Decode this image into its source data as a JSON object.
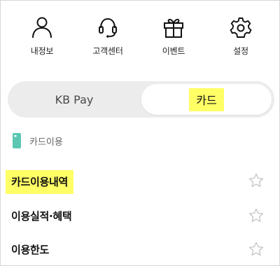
{
  "quick_menu": [
    {
      "label": "내정보",
      "icon": "person-icon"
    },
    {
      "label": "고객센터",
      "icon": "headset-icon"
    },
    {
      "label": "이벤트",
      "icon": "gift-icon"
    },
    {
      "label": "설정",
      "icon": "gear-icon"
    }
  ],
  "toggle": {
    "left_label": "KB Pay",
    "right_label": "카드",
    "selected": "카드"
  },
  "section": {
    "title": "카드이용",
    "icon": "card-icon",
    "icon_color": "#5cc8b4"
  },
  "list": [
    {
      "label": "카드이용내역",
      "highlighted": true
    },
    {
      "label": "이용실적·혜택",
      "highlighted": false
    },
    {
      "label": "이용한도",
      "highlighted": false
    }
  ],
  "colors": {
    "highlight": "#ffff66",
    "toggle_bg": "#ececec",
    "star_outline": "#c8c8c8"
  }
}
